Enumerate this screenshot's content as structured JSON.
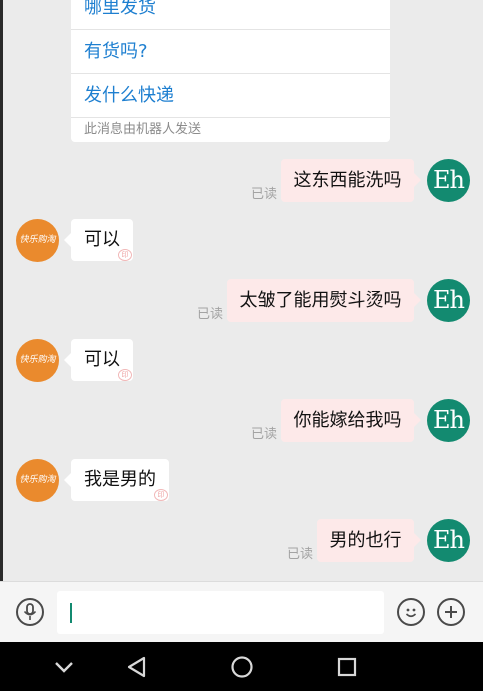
{
  "bot_menu": {
    "options": [
      "哪里发货",
      "有货吗?",
      "发什么快递"
    ],
    "footnote": "此消息由机器人发送"
  },
  "messages": [
    {
      "side": "out",
      "text": "这东西能洗吗",
      "read": "已读",
      "avatar_text": "Eh"
    },
    {
      "side": "in",
      "text": "可以",
      "avatar_text": "快乐购淘"
    },
    {
      "side": "out",
      "text": "太皱了能用熨斗烫吗",
      "read": "已读",
      "avatar_text": "Eh"
    },
    {
      "side": "in",
      "text": "可以",
      "avatar_text": "快乐购淘"
    },
    {
      "side": "out",
      "text": "你能嫁给我吗",
      "read": "已读",
      "avatar_text": "Eh"
    },
    {
      "side": "in",
      "text": "我是男的",
      "avatar_text": "快乐购淘"
    },
    {
      "side": "out",
      "text": "男的也行",
      "read": "已读",
      "avatar_text": "Eh"
    }
  ],
  "input_bar": {
    "voice_icon": "microphone-icon",
    "emoji_icon": "smiley-icon",
    "plus_icon": "plus-icon",
    "input_value": ""
  },
  "nav_bar": {
    "icons": [
      "chevron-down-icon",
      "back-triangle-icon",
      "home-circle-icon",
      "recents-square-icon"
    ]
  },
  "colors": {
    "accent": "#138a70",
    "link": "#1e7fd0",
    "shop_avatar": "#ea8a2d",
    "outgoing_bubble": "#fde9e9"
  }
}
